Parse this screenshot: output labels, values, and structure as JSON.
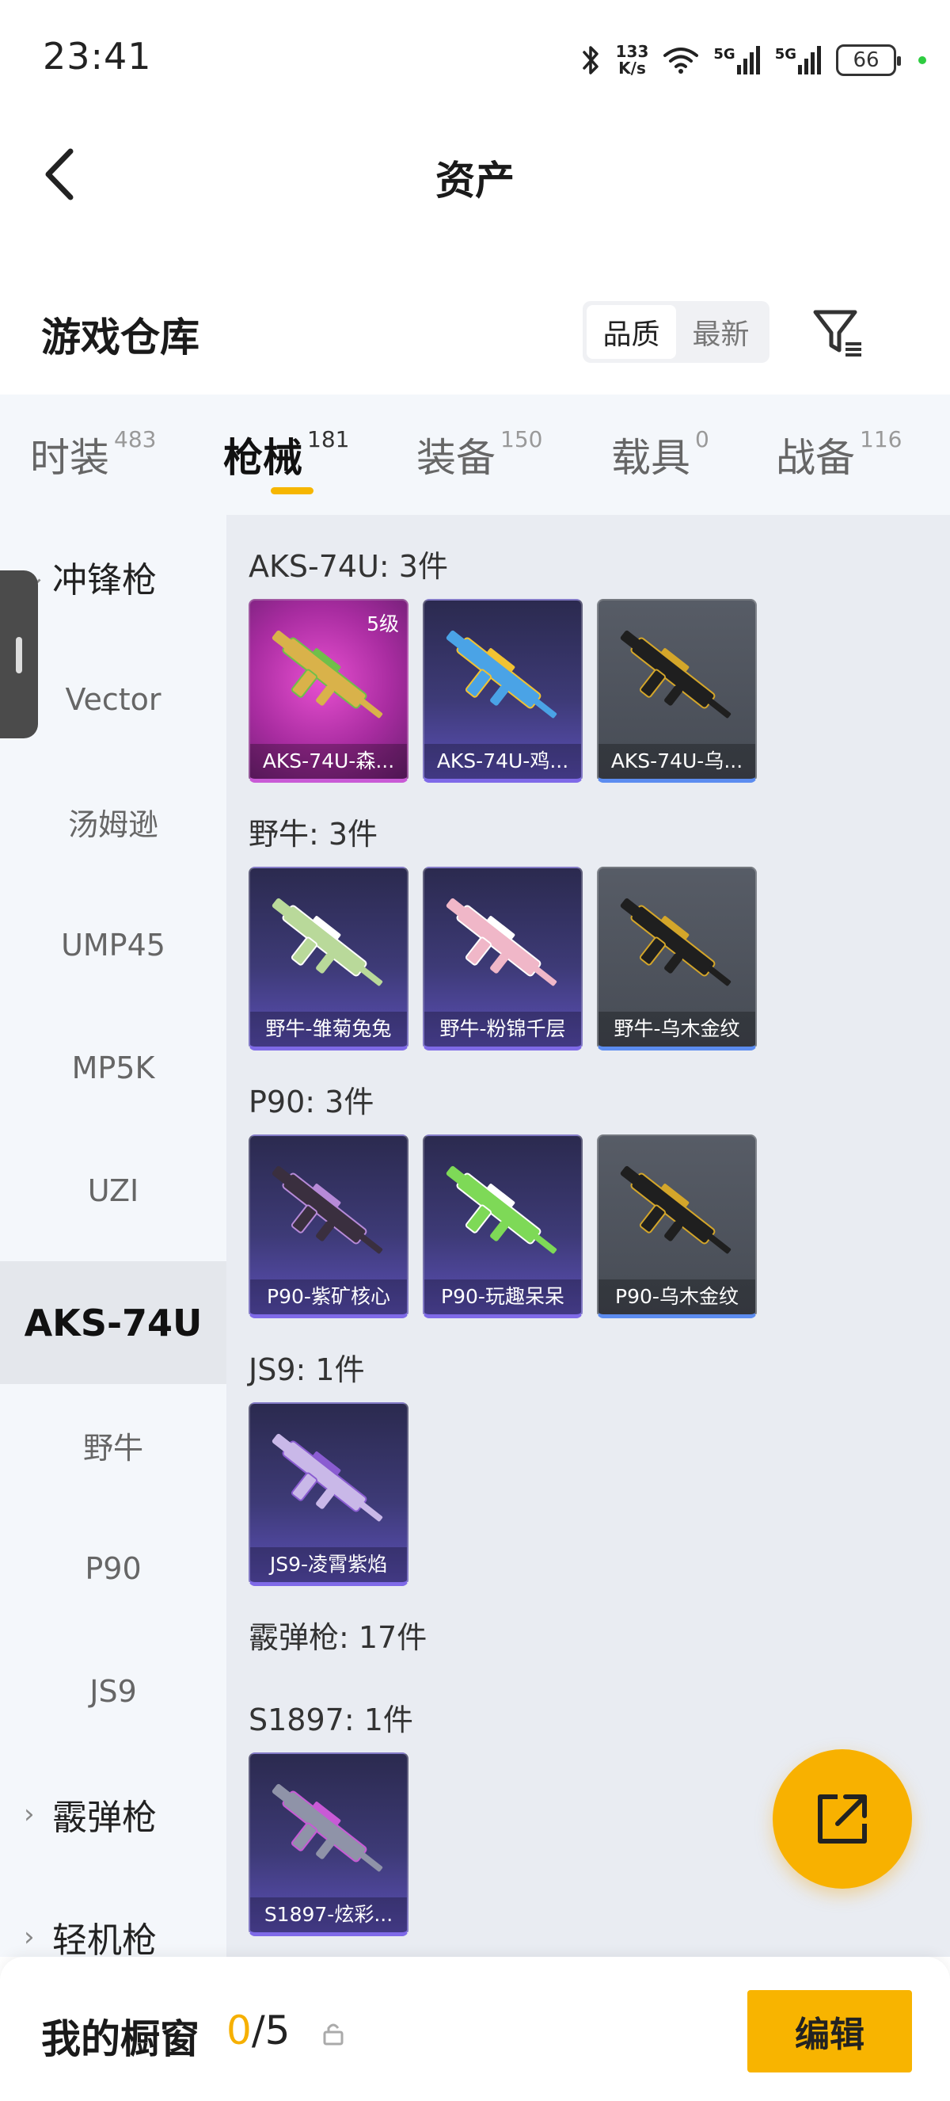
{
  "status_bar": {
    "time": "23:41",
    "net_speed_value": "133",
    "net_speed_unit": "K/s",
    "network_1": "5G",
    "network_2": "5G",
    "battery": "66"
  },
  "nav": {
    "title": "资产"
  },
  "warehouse": {
    "title": "游戏仓库",
    "sort_options": [
      "品质",
      "最新"
    ],
    "sort_selected": "品质"
  },
  "tabs": [
    {
      "name": "时装",
      "count": "483"
    },
    {
      "name": "枪械",
      "count": "181"
    },
    {
      "name": "装备",
      "count": "150"
    },
    {
      "name": "载具",
      "count": "0"
    },
    {
      "name": "战备",
      "count": "116"
    }
  ],
  "active_tab": "枪械",
  "sidebar": {
    "items": [
      {
        "label": "冲锋枪",
        "type": "group",
        "chevron": "chevron-down"
      },
      {
        "label": "Vector",
        "type": "sub"
      },
      {
        "label": "汤姆逊",
        "type": "sub"
      },
      {
        "label": "UMP45",
        "type": "sub"
      },
      {
        "label": "MP5K",
        "type": "sub"
      },
      {
        "label": "UZI",
        "type": "sub"
      },
      {
        "label": "AKS-74U",
        "type": "sub",
        "active": true
      },
      {
        "label": "野牛",
        "type": "sub"
      },
      {
        "label": "P90",
        "type": "sub"
      },
      {
        "label": "JS9",
        "type": "sub"
      },
      {
        "label": "霰弹枪",
        "type": "group",
        "chevron": ">"
      },
      {
        "label": "轻机枪",
        "type": "group",
        "chevron": ">"
      }
    ]
  },
  "groups": [
    {
      "title": "AKS-74U: 3件",
      "items": [
        {
          "name": "AKS-74U-森...",
          "level": "5级",
          "rarity": "pink",
          "gun_color": "#d9b24a",
          "accent": "#6fbf4a"
        },
        {
          "name": "AKS-74U-鸡...",
          "level": "",
          "rarity": "purple",
          "gun_color": "#4aa3e6",
          "accent": "#f1c232"
        },
        {
          "name": "AKS-74U-乌...",
          "level": "",
          "rarity": "gray",
          "gun_color": "#1f1f1f",
          "accent": "#d4a62a"
        }
      ]
    },
    {
      "title": "野牛: 3件",
      "items": [
        {
          "name": "野牛-雏菊兔兔",
          "level": "",
          "rarity": "purple",
          "gun_color": "#b9d99a",
          "accent": "#ffffff"
        },
        {
          "name": "野牛-粉锦千层",
          "level": "",
          "rarity": "purple",
          "gun_color": "#f0b7c8",
          "accent": "#ffffff"
        },
        {
          "name": "野牛-乌木金纹",
          "level": "",
          "rarity": "gray",
          "gun_color": "#1f1f1f",
          "accent": "#d4a62a"
        }
      ]
    },
    {
      "title": "P90: 3件",
      "items": [
        {
          "name": "P90-紫矿核心",
          "level": "",
          "rarity": "purple",
          "gun_color": "#3a2f3f",
          "accent": "#b78ad8"
        },
        {
          "name": "P90-玩趣呆呆",
          "level": "",
          "rarity": "purple",
          "gun_color": "#7ed957",
          "accent": "#ffffff"
        },
        {
          "name": "P90-乌木金纹",
          "level": "",
          "rarity": "gray",
          "gun_color": "#1f1f1f",
          "accent": "#d4a62a"
        }
      ]
    },
    {
      "title": "JS9: 1件",
      "items": [
        {
          "name": "JS9-凌霄紫焰",
          "level": "",
          "rarity": "purple",
          "gun_color": "#c9b8e8",
          "accent": "#8a5cd1"
        }
      ]
    },
    {
      "title": "霰弹枪: 17件",
      "items": []
    },
    {
      "title": "S1897: 1件",
      "items": [
        {
          "name": "S1897-炫彩...",
          "level": "",
          "rarity": "purple",
          "gun_color": "#8f93a8",
          "accent": "#c85ad6"
        }
      ]
    }
  ],
  "showcase": {
    "title": "我的橱窗",
    "current": "0",
    "total": "/5",
    "edit_label": "编辑"
  },
  "colors": {
    "accent": "#f8b400",
    "tab_underline": "#f6b600",
    "count_current": "#f6b000"
  }
}
